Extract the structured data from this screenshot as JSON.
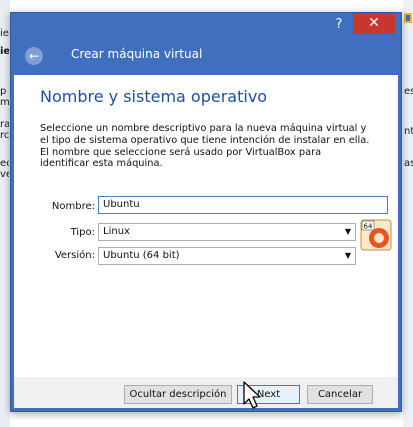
{
  "background": {
    "left_fragments": [
      "ie",
      "ie",
      "p",
      "m",
      "ra",
      "rc",
      "ec",
      "ve"
    ],
    "right_fragments": [
      "es",
      "nt",
      "as"
    ]
  },
  "dialog": {
    "help_label": "?",
    "close_label": "✕",
    "wizard_title": "Crear máquina virtual",
    "page_title": "Nombre y sistema operativo",
    "description": "Seleccione un nombre descriptivo para la nueva máquina virtual y el tipo de sistema operativo que tiene intención de instalar en ella. El nombre que seleccione será usado por VirtualBox para identificar esta máquina.",
    "name_label": "Nombre:",
    "name_value": "Ubuntu",
    "type_label": "Tipo:",
    "type_value": "Linux",
    "version_label": "Versión:",
    "version_value": "Ubuntu (64 bit)",
    "os_icon_badge": "64",
    "buttons": {
      "hide_description": "Ocultar descripción",
      "next": "Next",
      "cancel": "Cancelar"
    }
  },
  "colors": {
    "accent": "#3f6fbe",
    "title_blue": "#1f4fa0",
    "close_red": "#c7372f"
  }
}
